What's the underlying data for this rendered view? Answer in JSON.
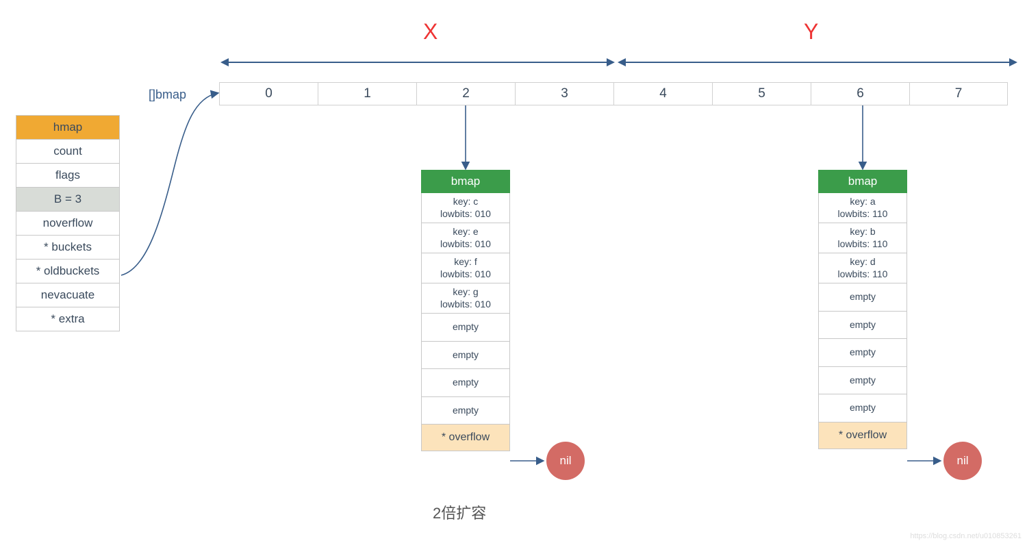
{
  "hmap": {
    "header": "hmap",
    "rows": [
      "count",
      "flags",
      "B = 3",
      "noverflow",
      "* buckets",
      "* oldbuckets",
      "nevacuate",
      "* extra"
    ],
    "highlight_index": 2
  },
  "buckets_label": "[]bmap",
  "bucket_indices": [
    "0",
    "1",
    "2",
    "3",
    "4",
    "5",
    "6",
    "7"
  ],
  "labels": {
    "x": "X",
    "y": "Y"
  },
  "bmap_x": {
    "header": "bmap",
    "slots": [
      "key: c\nlowbits: 010",
      "key: e\nlowbits: 010",
      "key: f\nlowbits: 010",
      "key: g\nlowbits: 010",
      "empty",
      "empty",
      "empty",
      "empty"
    ],
    "overflow": "* overflow",
    "nil": "nil"
  },
  "bmap_y": {
    "header": "bmap",
    "slots": [
      "key: a\nlowbits: 110",
      "key: b\nlowbits: 110",
      "key: d\nlowbits: 110",
      "empty",
      "empty",
      "empty",
      "empty",
      "empty"
    ],
    "overflow": "* overflow",
    "nil": "nil"
  },
  "caption": "2倍扩容",
  "watermark": "https://blog.csdn.net/u010853261",
  "colors": {
    "hmap_header": "#f0a933",
    "bmap_header": "#3b9c4a",
    "overflow_bg": "#fce3bb",
    "nil_bg": "#d36b65",
    "arrow": "#385d8a",
    "label_red": "#e33"
  }
}
